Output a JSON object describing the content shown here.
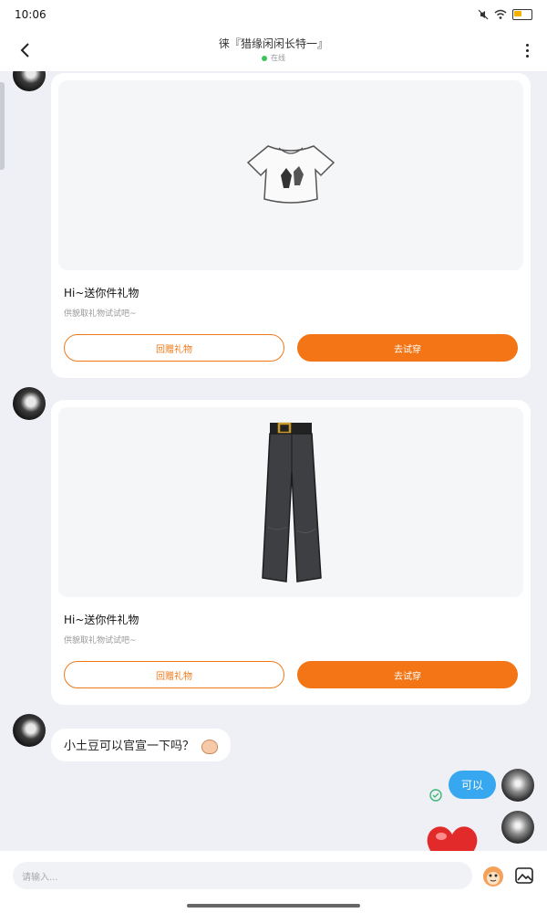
{
  "status_bar": {
    "time": "10:06"
  },
  "header": {
    "title": "徕『猎缘闲闲长特一』",
    "status": "在线"
  },
  "messages": {
    "gift1": {
      "title": "Hi~送你件礼物",
      "subtitle": "供貌取礼物试试吧~",
      "return_label": "回赠礼物",
      "try_label": "去试穿"
    },
    "gift2": {
      "title": "Hi~送你件礼物",
      "subtitle": "供貌取礼物试试吧~",
      "return_label": "回赠礼物",
      "try_label": "去试穿"
    },
    "text1": "小土豆可以官宣一下吗？",
    "reply1": "可以"
  },
  "input": {
    "placeholder": "请输入..."
  },
  "colors": {
    "accent": "#f37515",
    "bubble_blue": "#37a8f0",
    "online": "#3cc45a"
  },
  "icons": [
    "back-arrow-icon",
    "more-vertical-icon",
    "check-circle-icon",
    "heart-sticker",
    "emoji-icon",
    "image-icon"
  ]
}
